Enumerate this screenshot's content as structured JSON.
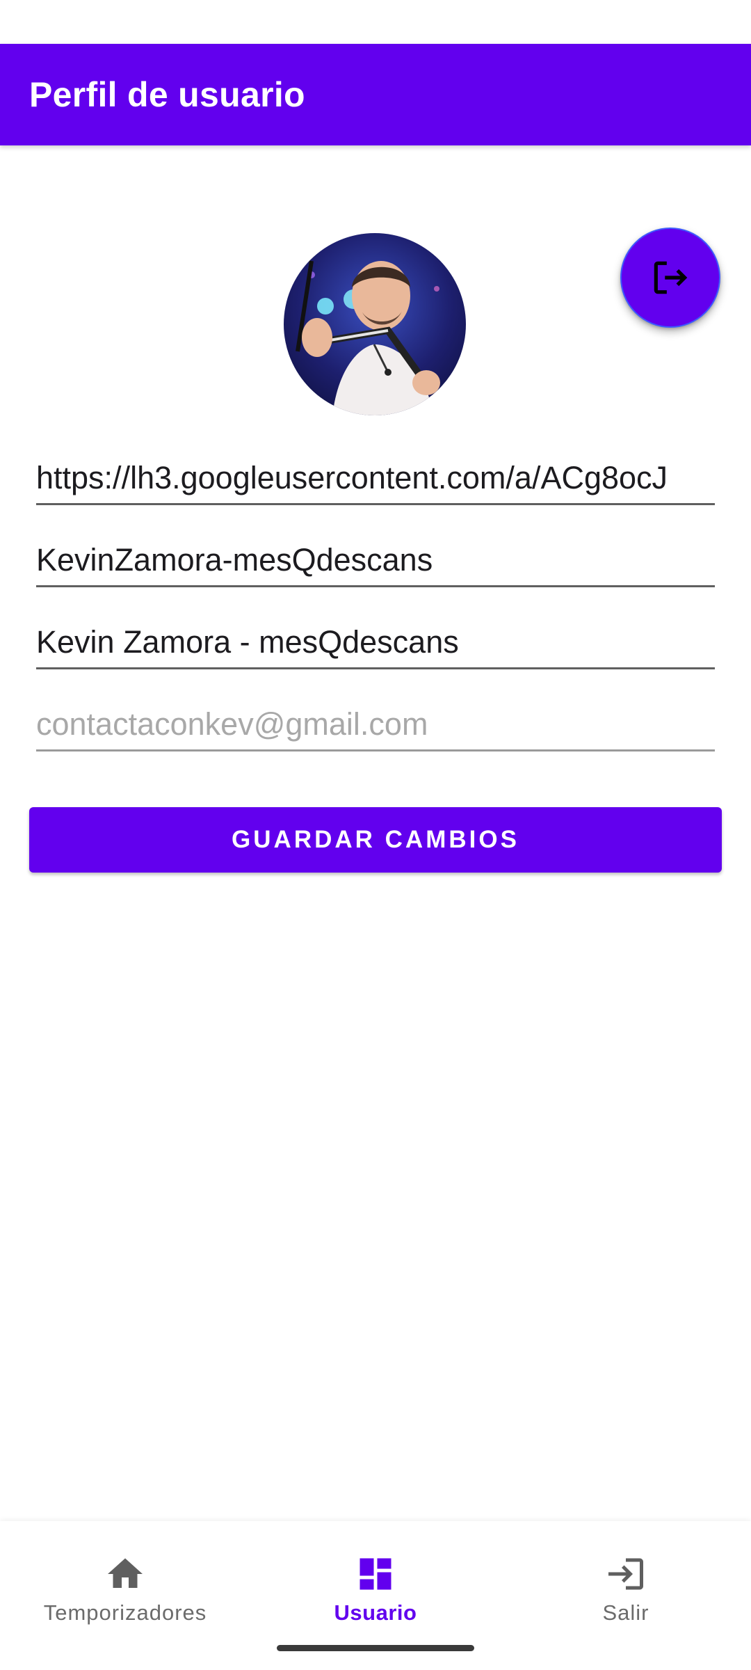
{
  "app_bar": {
    "title": "Perfil de usuario"
  },
  "profile": {
    "avatar_icon": "profile-photo"
  },
  "fab": {
    "icon": "logout-icon"
  },
  "form": {
    "photo_url": "https://lh3.googleusercontent.com/a/ACg8ocJ",
    "username": "KevinZamora-mesQdescans",
    "display_name": "Kevin Zamora - mesQdescans",
    "email_placeholder": "contactaconkev@gmail.com",
    "save_label": "GUARDAR CAMBIOS"
  },
  "bottom_nav": {
    "items": [
      {
        "label": "Temporizadores",
        "icon": "home-icon",
        "active": false
      },
      {
        "label": "Usuario",
        "icon": "dashboard-icon",
        "active": true
      },
      {
        "label": "Salir",
        "icon": "login-icon",
        "active": false
      }
    ]
  },
  "colors": {
    "primary": "#6200ee",
    "on_primary": "#ffffff",
    "nav_inactive": "#6b6b6b"
  }
}
